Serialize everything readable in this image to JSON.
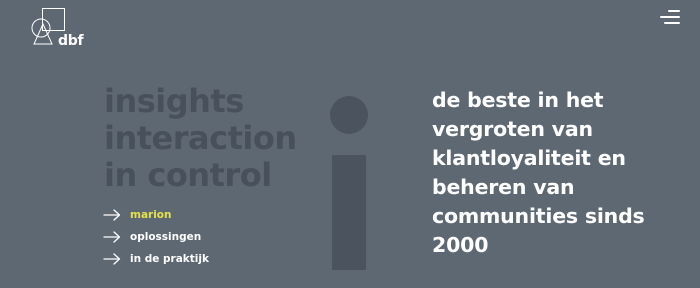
{
  "brand": {
    "logo_text": "dbf",
    "logo_icon": "dbf-logo-icon"
  },
  "header": {
    "menu_icon": "hamburger-menu-icon"
  },
  "hero": {
    "tagline_lines": [
      "insights",
      "interaction",
      "in control"
    ],
    "decorative_letter": "i",
    "headline_lines": [
      "de beste in het",
      "vergroten van",
      "klantloyaliteit en",
      "beheren van",
      "communities sinds",
      "2000"
    ]
  },
  "nav": {
    "arrow_icon": "arrow-right-icon",
    "items": [
      {
        "label": "marion",
        "active": true
      },
      {
        "label": "oplossingen",
        "active": false
      },
      {
        "label": "in de praktijk",
        "active": false
      }
    ]
  },
  "colors": {
    "background": "#5e6873",
    "tagline": "#48515b",
    "big_letter": "#4b545e",
    "text": "#ffffff",
    "active_accent": "#e5e14c"
  }
}
